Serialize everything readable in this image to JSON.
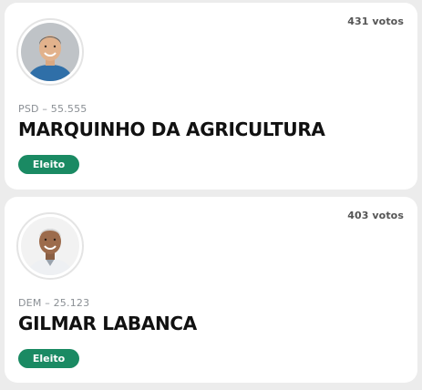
{
  "colors": {
    "page_background": "#ececec",
    "card_background": "#ffffff",
    "badge_green": "#1a8a63",
    "name_text": "#111111",
    "party_text": "#8a8f94"
  },
  "candidates": [
    {
      "votes": "431 votos",
      "party_number": "PSD – 55.555",
      "name": "MARQUINHO DA AGRICULTURA",
      "status": "Eleito",
      "photo_icon": "candidate-photo"
    },
    {
      "votes": "403 votos",
      "party_number": "DEM – 25.123",
      "name": "GILMAR LABANCA",
      "status": "Eleito",
      "photo_icon": "candidate-photo"
    }
  ]
}
